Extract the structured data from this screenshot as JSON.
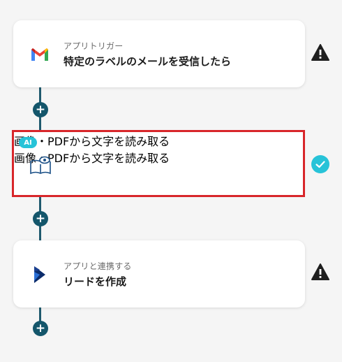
{
  "steps": [
    {
      "subtitle": "アプリトリガー",
      "title": "特定のラベルのメールを受信したら",
      "icon": "gmail-icon",
      "status": "warning"
    },
    {
      "subtitle": "画像・PDFから文字を読み取る",
      "title": "画像・PDFから文字を読み取る",
      "icon": "ocr-book-eye-icon",
      "status": "done",
      "badge": "AI"
    },
    {
      "subtitle": "アプリと連携する",
      "title": "リードを作成",
      "icon": "dynamics-icon",
      "status": "warning"
    }
  ],
  "add_button_label": "+",
  "colors": {
    "connector": "#1f5a6e",
    "add_button": "#14566b",
    "ai_badge": "#27c3d8",
    "success": "#27c3d8",
    "selected_border": "#d8262a"
  }
}
